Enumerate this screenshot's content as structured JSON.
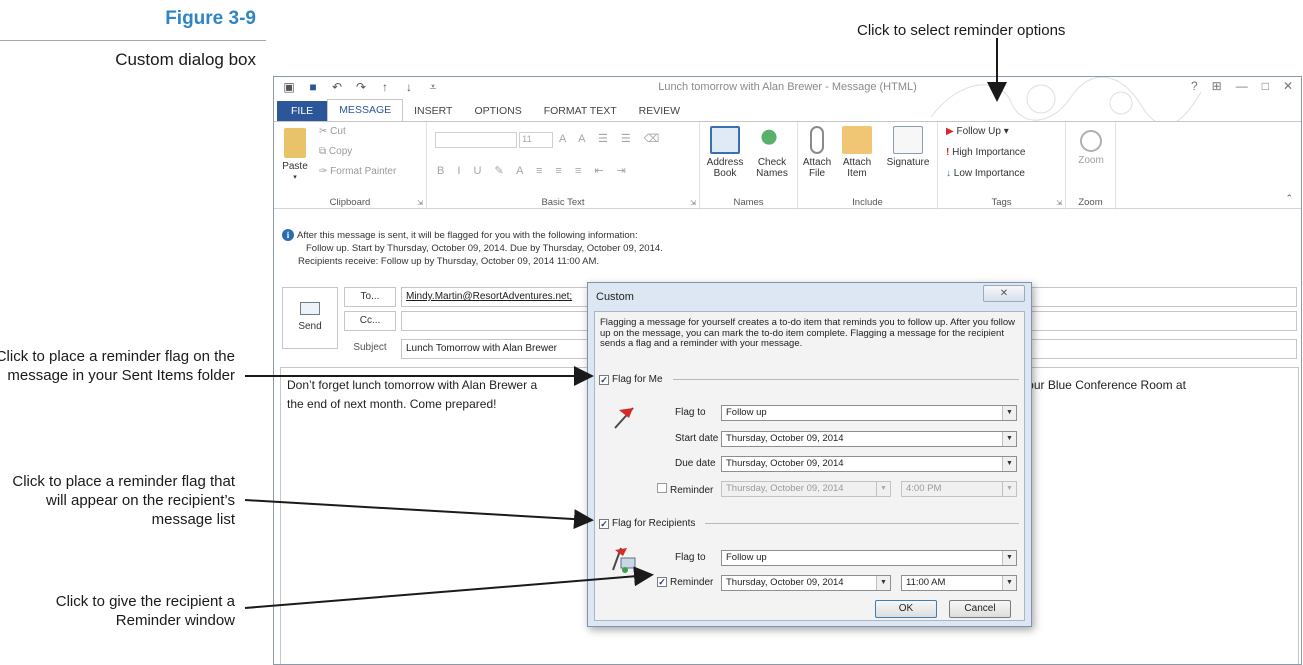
{
  "figure": {
    "number": "Figure 3-9",
    "caption": "Custom dialog box",
    "callouts": {
      "reminder_options": "Click to select reminder options",
      "flag_for_me": "Click to place a reminder flag on the message in your Sent Items folder",
      "flag_for_recipients": "Click to place a reminder flag that will appear on the recipient’s message list",
      "reminder_window": "Click to give the recipient a Reminder window"
    }
  },
  "window": {
    "title": "Lunch tomorrow with Alan Brewer - Message (HTML)",
    "controls": [
      "?",
      "⊞",
      "—",
      "□",
      "✕"
    ]
  },
  "tabs": [
    "FILE",
    "MESSAGE",
    "INSERT",
    "OPTIONS",
    "FORMAT TEXT",
    "REVIEW"
  ],
  "ribbon": {
    "clipboard": {
      "paste": "Paste",
      "cut": "Cut",
      "copy": "Copy",
      "format_painter": "Format Painter",
      "label": "Clipboard"
    },
    "basic_text": {
      "font_size": "11",
      "label": "Basic Text"
    },
    "names": {
      "address_book": "Address Book",
      "check_names": "Check Names",
      "label": "Names"
    },
    "include": {
      "attach_file": "Attach File",
      "attach_item": "Attach Item",
      "signature": "Signature",
      "label": "Include"
    },
    "tags": {
      "follow_up": "Follow Up",
      "high_importance": "High Importance",
      "low_importance": "Low Importance",
      "label": "Tags"
    },
    "zoom": {
      "zoom": "Zoom",
      "label": "Zoom"
    }
  },
  "infobar": {
    "line1": "After this message is sent, it will be flagged for you with the following information:",
    "line2": "Follow up.  Start by Thursday, October 09, 2014.  Due by Thursday, October 09, 2014.",
    "line3": "Recipients receive: Follow up by Thursday, October 09, 2014 11:00 AM."
  },
  "message": {
    "send": "Send",
    "to_button": "To...",
    "cc_button": "Cc...",
    "subject_label": "Subject",
    "to_value": "Mindy.Martin@ResortAdventures.net;",
    "cc_value": "",
    "subject_value": "Lunch Tomorrow with Alan Brewer",
    "body_left": "Don’t forget lunch tomorrow with Alan Brewer a",
    "body_right": "duled for our Blue Conference Room at",
    "body_line2": "the end of next month. Come prepared!"
  },
  "dialog": {
    "title": "Custom",
    "close": "✕",
    "description": "Flagging a message for yourself creates a to-do item that reminds you to follow up. After you follow up on the message, you can mark the to-do item complete. Flagging a message for the recipient sends a flag and a reminder with your message.",
    "flag_for_me": {
      "label": "Flag for Me",
      "checked": true
    },
    "flag_to_label": "Flag to",
    "flag_to_value": "Follow up",
    "start_date_label": "Start date",
    "start_date_value": "Thursday, October 09, 2014",
    "due_date_label": "Due date",
    "due_date_value": "Thursday, October 09, 2014",
    "reminder_label": "Reminder",
    "me_reminder": {
      "checked": false,
      "date": "Thursday, October 09, 2014",
      "time": "4:00 PM"
    },
    "flag_for_recipients": {
      "label": "Flag for Recipients",
      "checked": true
    },
    "recipient_flag_to_value": "Follow up",
    "recipient_reminder": {
      "checked": true,
      "date": "Thursday, October 09, 2014",
      "time": "11:00 AM"
    },
    "ok": "OK",
    "cancel": "Cancel"
  },
  "colors": {
    "accent": "#2b579a",
    "figure_blue": "#2f84c4",
    "flag_red": "#d62a2a"
  }
}
